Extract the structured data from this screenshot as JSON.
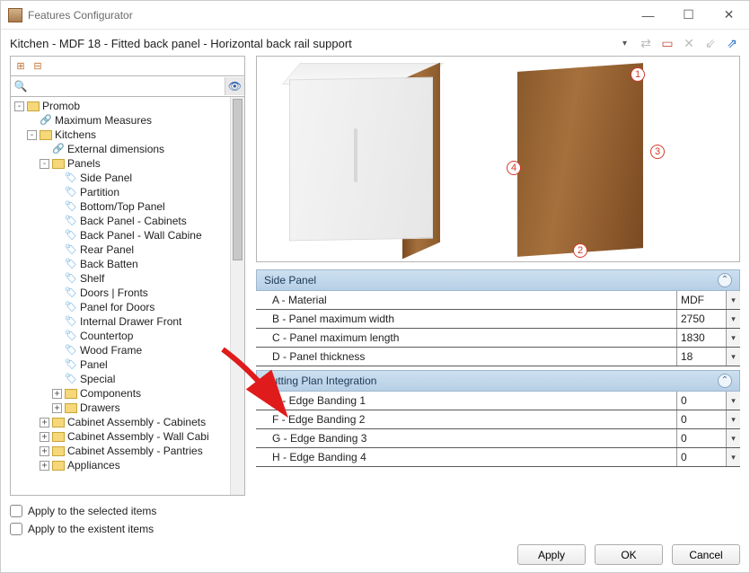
{
  "window": {
    "title": "Features Configurator"
  },
  "breadcrumb": "Kitchen - MDF 18 - Fitted back panel - Horizontal back rail support",
  "search": {
    "placeholder": ""
  },
  "tree": {
    "root": "Promob",
    "maximum_measures": "Maximum Measures",
    "kitchens": "Kitchens",
    "external_dimensions": "External dimensions",
    "panels": "Panels",
    "panel_items": {
      "side_panel": "Side Panel",
      "partition": "Partition",
      "bottom_top": "Bottom/Top Panel",
      "back_cab": "Back Panel - Cabinets",
      "back_wall": "Back Panel - Wall Cabine",
      "rear": "Rear Panel",
      "batten": "Back Batten",
      "shelf": "Shelf",
      "doors": "Doors | Fronts",
      "panel_doors": "Panel for Doors",
      "idf": "Internal Drawer Front",
      "countertop": "Countertop",
      "wood_frame": "Wood Frame",
      "panel": "Panel",
      "special": "Special",
      "components": "Components",
      "drawers": "Drawers"
    },
    "cab_asm_cab": "Cabinet Assembly - Cabinets",
    "cab_asm_wall": "Cabinet Assembly - Wall Cabi",
    "cab_asm_pan": "Cabinet Assembly - Pantries",
    "appliances": "Appliances"
  },
  "markers": {
    "m1": "1",
    "m2": "2",
    "m3": "3",
    "m4": "4"
  },
  "sections": {
    "side_panel": {
      "title": "Side Panel",
      "rows": {
        "a": {
          "k": "A - Material",
          "v": "MDF"
        },
        "b": {
          "k": "B - Panel maximum width",
          "v": "2750"
        },
        "c": {
          "k": "C - Panel maximum length",
          "v": "1830"
        },
        "d": {
          "k": "D - Panel thickness",
          "v": "18"
        }
      }
    },
    "cutting_plan": {
      "title": "Cutting Plan Integration",
      "rows": {
        "e": {
          "k": "E - Edge Banding 1",
          "v": "0"
        },
        "f": {
          "k": "F - Edge Banding 2",
          "v": "0"
        },
        "g": {
          "k": "G - Edge Banding 3",
          "v": "0"
        },
        "h": {
          "k": "H - Edge Banding 4",
          "v": "0"
        }
      }
    }
  },
  "options": {
    "apply_selected": "Apply to the selected items",
    "apply_existent": "Apply to the existent items"
  },
  "buttons": {
    "apply": "Apply",
    "ok": "OK",
    "cancel": "Cancel"
  }
}
